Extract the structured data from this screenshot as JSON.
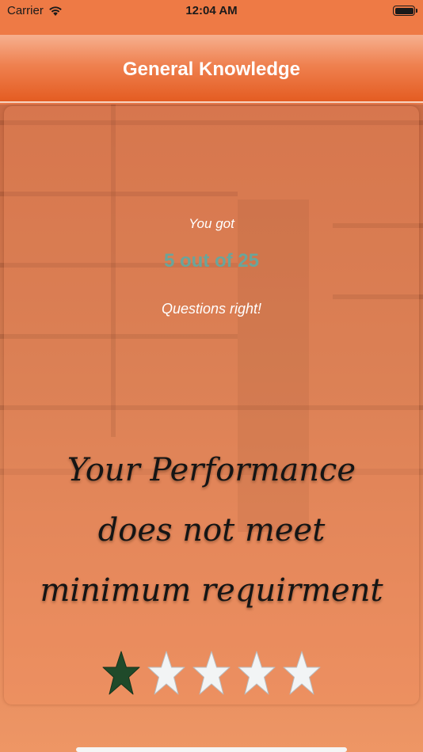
{
  "status_bar": {
    "carrier": "Carrier",
    "time": "12:04 AM"
  },
  "nav": {
    "title": "General Knowledge"
  },
  "result": {
    "intro": "You got",
    "score": "5 out of 25",
    "outro": "Questions right!",
    "message": "Your Performance does not meet minimum requirment"
  },
  "rating": {
    "max": 5,
    "value": 1,
    "filled_color": "#1f4a2a",
    "empty_color": "#f2f4f5"
  },
  "icons": {
    "wifi": "wifi-icon",
    "battery": "battery-icon",
    "star": "star-icon"
  }
}
